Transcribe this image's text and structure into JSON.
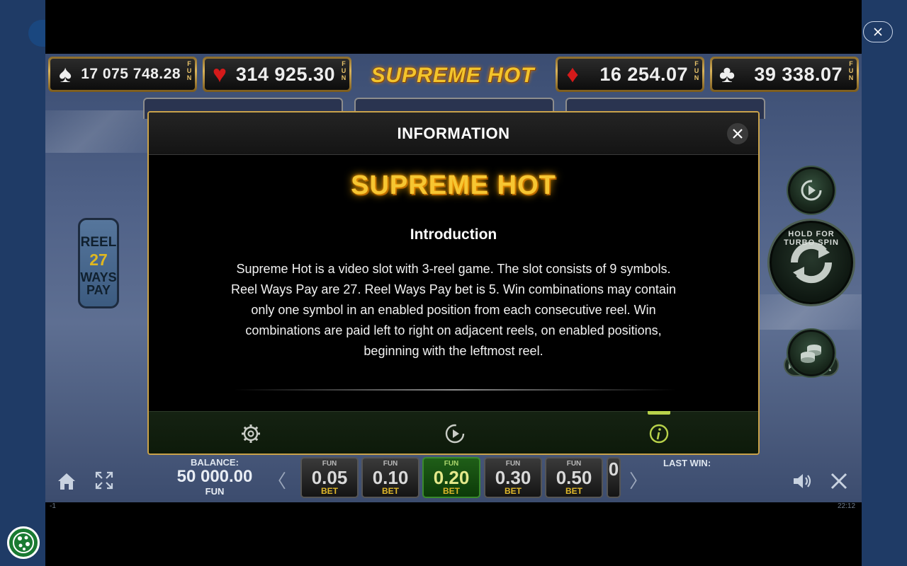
{
  "jackpots": [
    {
      "suit": "♠",
      "value": "17 075 748.28",
      "tag": "FUN",
      "suit_color": "#111111"
    },
    {
      "suit": "♥",
      "value": "314 925.30",
      "tag": "FUN",
      "suit_color": "#d51a1a"
    },
    {
      "suit": "♦",
      "value": "16 254.07",
      "tag": "FUN",
      "suit_color": "#d51a1a"
    },
    {
      "suit": "♣",
      "value": "39 338.07",
      "tag": "FUN",
      "suit_color": "#111111"
    }
  ],
  "game_logo": "SUPREME HOT",
  "reel_ways": {
    "line1": "REEL",
    "line2": "27",
    "line3": "WAYS",
    "line4": "PAY"
  },
  "spin": {
    "turbo_hint": "HOLD FOR TURBO SPIN"
  },
  "balance": {
    "label": "BALANCE:",
    "amount": "50 000.00",
    "unit": "FUN"
  },
  "bets": [
    {
      "fun": "FUN",
      "value": "0.05",
      "bet": "BET"
    },
    {
      "fun": "FUN",
      "value": "0.10",
      "bet": "BET"
    },
    {
      "fun": "FUN",
      "value": "0.20",
      "bet": "BET"
    },
    {
      "fun": "FUN",
      "value": "0.30",
      "bet": "BET"
    },
    {
      "fun": "FUN",
      "value": "0.50",
      "bet": "BET"
    },
    {
      "fun": "",
      "value": "0",
      "bet": ""
    }
  ],
  "selected_bet": "0.20",
  "last_win_label": "LAST WIN:",
  "corner_label": "-1",
  "clock": "22:12",
  "modal": {
    "title": "INFORMATION",
    "logo": "SUPREME HOT",
    "section_title": "Introduction",
    "body": "Supreme Hot is a video slot with 3-reel game. The slot consists of 9 symbols. Reel Ways Pay are 27. Reel Ways Pay bet is 5. Win combinations may contain only one symbol in an enabled position from each consecutive reel. Win combinations are paid left to right on adjacent reels, on enabled positions, beginning with the leftmost reel.",
    "active_tab": "info"
  },
  "colors": {
    "accent_gold": "#c9a24a",
    "active_green": "#b8d24a",
    "cookie_green": "#1a7a32"
  }
}
